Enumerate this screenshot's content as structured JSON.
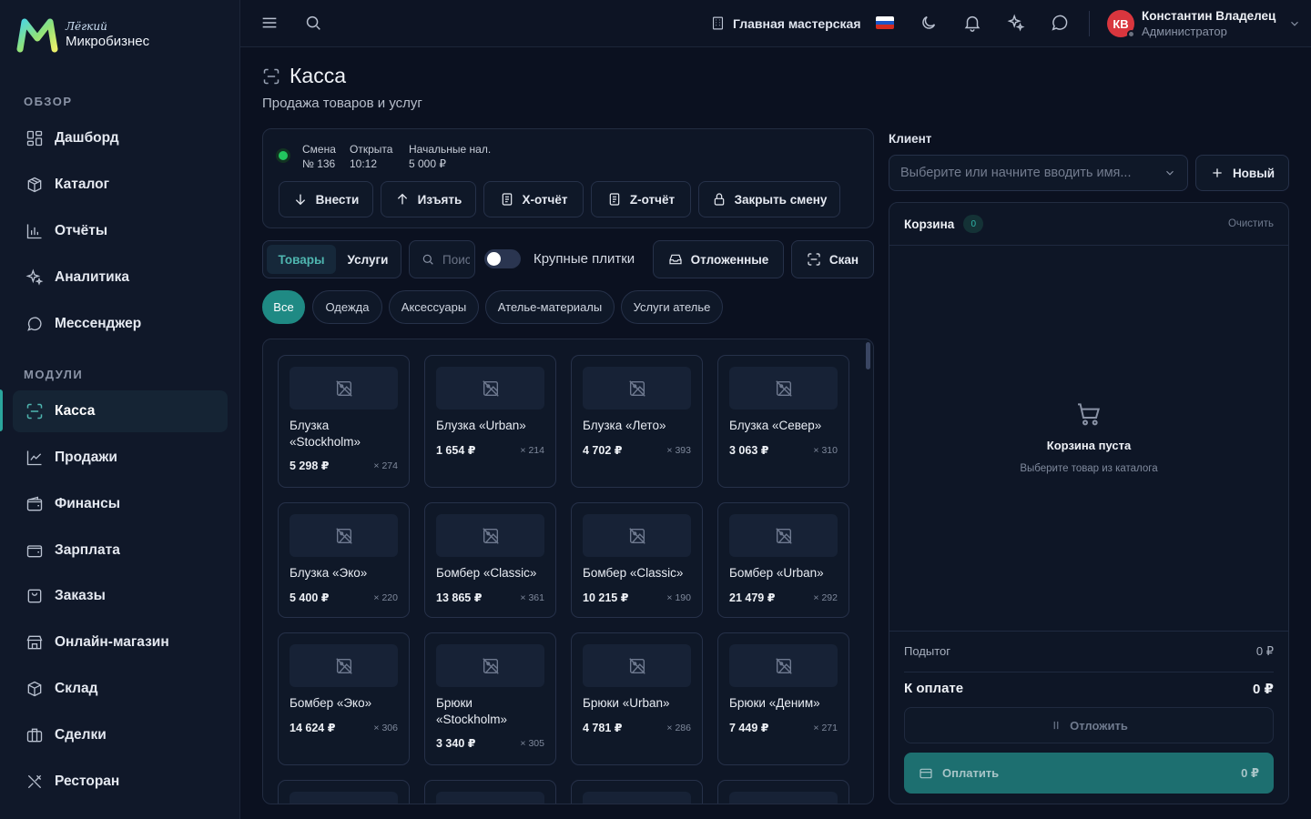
{
  "brand": {
    "line1": "Лёгкий",
    "line2": "Микробизнес"
  },
  "sidebar": {
    "sections": [
      {
        "label": "ОБЗОР",
        "items": [
          {
            "id": "dashboard",
            "label": "Дашборд",
            "icon": "grid-icon"
          },
          {
            "id": "catalog",
            "label": "Каталог",
            "icon": "box-icon"
          },
          {
            "id": "reports",
            "label": "Отчёты",
            "icon": "bar-chart-icon"
          },
          {
            "id": "analytics",
            "label": "Аналитика",
            "icon": "sparkles-icon"
          },
          {
            "id": "messenger",
            "label": "Мессенджер",
            "icon": "chat-icon"
          }
        ]
      },
      {
        "label": "МОДУЛИ",
        "items": [
          {
            "id": "kassa",
            "label": "Касса",
            "icon": "scan-icon",
            "active": true
          },
          {
            "id": "sales",
            "label": "Продажи",
            "icon": "line-chart-icon"
          },
          {
            "id": "finance",
            "label": "Финансы",
            "icon": "wallet-icon"
          },
          {
            "id": "salary",
            "label": "Зарплата",
            "icon": "wallet-icon"
          },
          {
            "id": "orders",
            "label": "Заказы",
            "icon": "bag-icon"
          },
          {
            "id": "shop",
            "label": "Онлайн-магазин",
            "icon": "store-icon"
          },
          {
            "id": "warehouse",
            "label": "Склад",
            "icon": "package-icon"
          },
          {
            "id": "deals",
            "label": "Сделки",
            "icon": "briefcase-icon"
          },
          {
            "id": "restaurant",
            "label": "Ресторан",
            "icon": "utensils-icon"
          }
        ]
      }
    ]
  },
  "topbar": {
    "workshop": "Главная мастерская",
    "user": {
      "initials": "КВ",
      "name": "Константин Владелец",
      "role": "Администратор"
    }
  },
  "page": {
    "title": "Касса",
    "subtitle": "Продажа товаров и услуг"
  },
  "shift": {
    "label_shift": "Смена",
    "value_shift": "№ 136",
    "label_open": "Открыта",
    "value_open": "10:12",
    "label_cash": "Начальные нал.",
    "value_cash": "5 000 ₽",
    "buttons": {
      "deposit": "Внести",
      "withdraw": "Изъять",
      "x_report": "X-отчёт",
      "z_report": "Z-отчёт",
      "close": "Закрыть смену"
    }
  },
  "toolbar": {
    "tab_goods": "Товары",
    "tab_services": "Услуги",
    "search_placeholder": "Поиск",
    "toggle_label": "Крупные плитки",
    "deferred": "Отложенные",
    "scan": "Скан"
  },
  "categories": [
    "Все",
    "Одежда",
    "Аксессуары",
    "Ателье-материалы",
    "Услуги ателье"
  ],
  "products": [
    {
      "name": "Блузка «Stockholm»",
      "price": "5 298 ₽",
      "stock": "× 274"
    },
    {
      "name": "Блузка «Urban»",
      "price": "1 654 ₽",
      "stock": "× 214"
    },
    {
      "name": "Блузка «Лето»",
      "price": "4 702 ₽",
      "stock": "× 393"
    },
    {
      "name": "Блузка «Север»",
      "price": "3 063 ₽",
      "stock": "× 310"
    },
    {
      "name": "Блузка «Эко»",
      "price": "5 400 ₽",
      "stock": "× 220"
    },
    {
      "name": "Бомбер «Classic»",
      "price": "13 865 ₽",
      "stock": "× 361"
    },
    {
      "name": "Бомбер «Classic»",
      "price": "10 215 ₽",
      "stock": "× 190"
    },
    {
      "name": "Бомбер «Urban»",
      "price": "21 479 ₽",
      "stock": "× 292"
    },
    {
      "name": "Бомбер «Эко»",
      "price": "14 624 ₽",
      "stock": "× 306"
    },
    {
      "name": "Брюки «Stockholm»",
      "price": "3 340 ₽",
      "stock": "× 305"
    },
    {
      "name": "Брюки «Urban»",
      "price": "4 781 ₽",
      "stock": "× 286"
    },
    {
      "name": "Брюки «Деним»",
      "price": "7 449 ₽",
      "stock": "× 271"
    }
  ],
  "client": {
    "label": "Клиент",
    "placeholder": "Выберите или начните вводить имя...",
    "new_button": "Новый"
  },
  "cart": {
    "title": "Корзина",
    "count": "0",
    "clear": "Очистить",
    "empty_title": "Корзина пуста",
    "empty_sub": "Выберите товар из каталога",
    "subtotal_label": "Подытог",
    "subtotal_value": "0 ₽",
    "total_label": "К оплате",
    "total_value": "0 ₽",
    "defer_button": "Отложить",
    "pay_button": "Оплатить",
    "pay_value": "0 ₽"
  },
  "colors": {
    "accent": "#1f8a84",
    "background": "#0b1120",
    "sidebar": "#101829",
    "avatar": "#d9363e",
    "status_online": "#22c55e"
  }
}
